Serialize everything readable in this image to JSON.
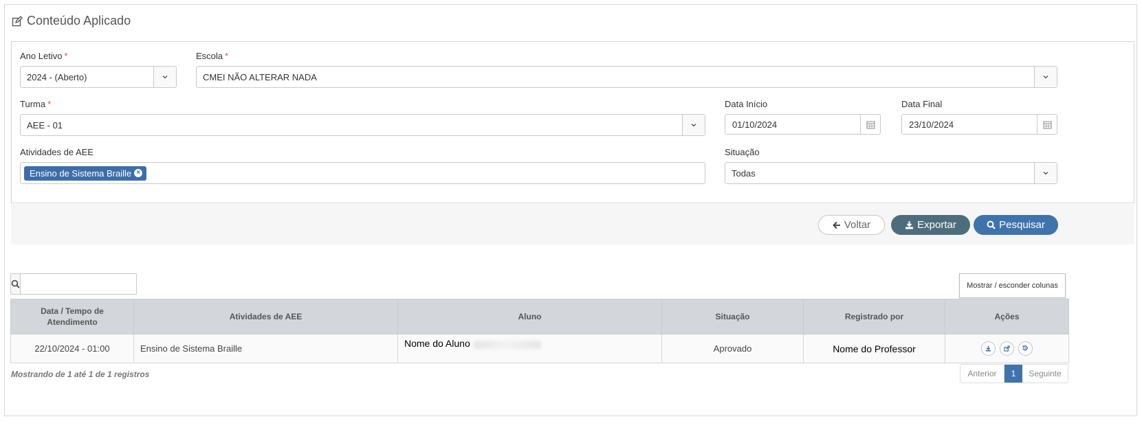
{
  "page": {
    "title": "Conteúdo Aplicado"
  },
  "filters": {
    "ano_letivo": {
      "label": "Ano Letivo",
      "required": "*",
      "value": "2024 - (Aberto)"
    },
    "escola": {
      "label": "Escola",
      "required": "*",
      "value": "CMEI NÃO ALTERAR NADA"
    },
    "turma": {
      "label": "Turma",
      "required": "*",
      "value": "AEE - 01"
    },
    "data_inicio": {
      "label": "Data Início",
      "value": "01/10/2024"
    },
    "data_final": {
      "label": "Data Final",
      "value": "23/10/2024"
    },
    "atividades": {
      "label": "Atividades de AEE",
      "tag": "Ensino de Sistema Braille"
    },
    "situacao": {
      "label": "Situação",
      "value": "Todas"
    }
  },
  "actions": {
    "voltar": "Voltar",
    "exportar": "Exportar",
    "pesquisar": "Pesquisar"
  },
  "table": {
    "search_value": "",
    "toggle_columns": "Mostrar / esconder colunas",
    "columns": [
      "Data / Tempo de Atendimento",
      "Atividades de AEE",
      "Aluno",
      "Situação",
      "Registrado por",
      "Ações"
    ],
    "rows": [
      {
        "data": "22/10/2024 - 01:00",
        "atividade": "Ensino de Sistema Braille",
        "aluno": "Nome do Aluno",
        "situacao": "Aprovado",
        "registrado_por": "Nome do Professor"
      }
    ],
    "info": "Mostrando de 1 até 1 de 1 registros",
    "pager": {
      "prev": "Anterior",
      "current": "1",
      "next": "Seguinte"
    }
  },
  "colors": {
    "primary": "#3f73ac",
    "export": "#4e6d7c",
    "required": "#d9534f",
    "header_bg": "#d3d7dc"
  },
  "icons": [
    "edit-icon",
    "chevron-down-icon",
    "calendar-icon",
    "close-circle-icon",
    "arrow-left-icon",
    "download-icon",
    "search-icon",
    "share-icon",
    "history-icon"
  ]
}
